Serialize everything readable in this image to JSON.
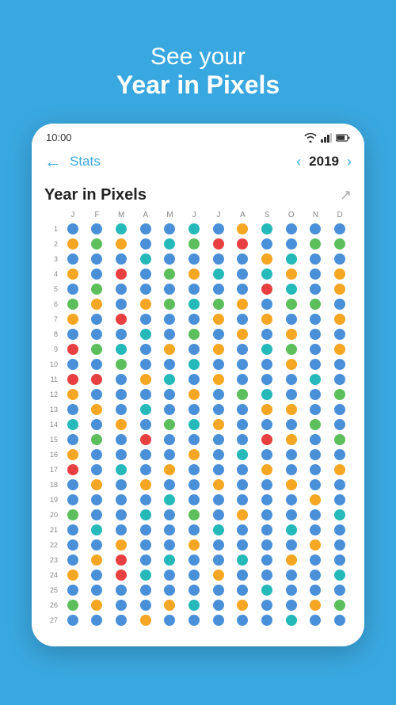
{
  "hero": {
    "line1": "See your",
    "line2": "Year in Pixels"
  },
  "statusBar": {
    "time": "10:00"
  },
  "nav": {
    "backLabel": "←",
    "statsLabel": "Stats",
    "chevronLeft": "‹",
    "chevronRight": "›",
    "year": "2019"
  },
  "section": {
    "title": "Year in Pixels",
    "shareIcon": "↗"
  },
  "months": [
    "J",
    "F",
    "M",
    "A",
    "M",
    "J",
    "J",
    "A",
    "S",
    "O",
    "N",
    "D"
  ],
  "rows": [
    {
      "day": 1,
      "dots": [
        "blue",
        "blue",
        "teal",
        "blue",
        "blue",
        "teal",
        "blue",
        "orange",
        "teal",
        "blue",
        "blue",
        "blue"
      ]
    },
    {
      "day": 2,
      "dots": [
        "orange",
        "green",
        "orange",
        "blue",
        "teal",
        "green",
        "red",
        "red",
        "blue",
        "blue",
        "green",
        "green"
      ]
    },
    {
      "day": 3,
      "dots": [
        "blue",
        "blue",
        "blue",
        "teal",
        "blue",
        "blue",
        "blue",
        "blue",
        "orange",
        "teal",
        "blue",
        "blue"
      ]
    },
    {
      "day": 4,
      "dots": [
        "orange",
        "blue",
        "red",
        "blue",
        "green",
        "orange",
        "teal",
        "blue",
        "teal",
        "orange",
        "blue",
        "orange"
      ]
    },
    {
      "day": 5,
      "dots": [
        "blue",
        "green",
        "blue",
        "blue",
        "blue",
        "blue",
        "blue",
        "blue",
        "red",
        "teal",
        "blue",
        "orange"
      ]
    },
    {
      "day": 6,
      "dots": [
        "green",
        "orange",
        "blue",
        "orange",
        "green",
        "teal",
        "green",
        "orange",
        "blue",
        "green",
        "green",
        "blue"
      ]
    },
    {
      "day": 7,
      "dots": [
        "orange",
        "blue",
        "red",
        "blue",
        "blue",
        "blue",
        "orange",
        "blue",
        "orange",
        "blue",
        "blue",
        "orange"
      ]
    },
    {
      "day": 8,
      "dots": [
        "blue",
        "blue",
        "blue",
        "teal",
        "blue",
        "green",
        "blue",
        "orange",
        "blue",
        "orange",
        "blue",
        "blue"
      ]
    },
    {
      "day": 9,
      "dots": [
        "red",
        "green",
        "teal",
        "blue",
        "orange",
        "blue",
        "orange",
        "blue",
        "teal",
        "green",
        "blue",
        "orange"
      ]
    },
    {
      "day": 10,
      "dots": [
        "blue",
        "blue",
        "green",
        "blue",
        "blue",
        "teal",
        "blue",
        "blue",
        "blue",
        "orange",
        "blue",
        "blue"
      ]
    },
    {
      "day": 11,
      "dots": [
        "red",
        "red",
        "blue",
        "orange",
        "teal",
        "blue",
        "orange",
        "blue",
        "blue",
        "blue",
        "teal",
        "blue"
      ]
    },
    {
      "day": 12,
      "dots": [
        "orange",
        "blue",
        "blue",
        "blue",
        "blue",
        "orange",
        "blue",
        "green",
        "teal",
        "blue",
        "blue",
        "green"
      ]
    },
    {
      "day": 13,
      "dots": [
        "blue",
        "orange",
        "blue",
        "teal",
        "blue",
        "blue",
        "blue",
        "blue",
        "orange",
        "orange",
        "blue",
        "blue"
      ]
    },
    {
      "day": 14,
      "dots": [
        "teal",
        "blue",
        "orange",
        "blue",
        "green",
        "teal",
        "orange",
        "blue",
        "blue",
        "blue",
        "green",
        "blue"
      ]
    },
    {
      "day": 15,
      "dots": [
        "blue",
        "green",
        "blue",
        "red",
        "blue",
        "blue",
        "blue",
        "blue",
        "red",
        "orange",
        "blue",
        "green"
      ]
    },
    {
      "day": 16,
      "dots": [
        "orange",
        "blue",
        "blue",
        "blue",
        "blue",
        "orange",
        "blue",
        "teal",
        "blue",
        "blue",
        "blue",
        "blue"
      ]
    },
    {
      "day": 17,
      "dots": [
        "red",
        "blue",
        "teal",
        "blue",
        "orange",
        "blue",
        "blue",
        "blue",
        "orange",
        "blue",
        "blue",
        "orange"
      ]
    },
    {
      "day": 18,
      "dots": [
        "blue",
        "orange",
        "blue",
        "orange",
        "blue",
        "blue",
        "orange",
        "blue",
        "blue",
        "orange",
        "blue",
        "blue"
      ]
    },
    {
      "day": 19,
      "dots": [
        "blue",
        "blue",
        "blue",
        "blue",
        "teal",
        "blue",
        "blue",
        "blue",
        "blue",
        "blue",
        "orange",
        "blue"
      ]
    },
    {
      "day": 20,
      "dots": [
        "green",
        "blue",
        "blue",
        "teal",
        "blue",
        "green",
        "blue",
        "orange",
        "blue",
        "blue",
        "blue",
        "teal"
      ]
    },
    {
      "day": 21,
      "dots": [
        "blue",
        "teal",
        "blue",
        "blue",
        "blue",
        "blue",
        "teal",
        "blue",
        "blue",
        "teal",
        "blue",
        "blue"
      ]
    },
    {
      "day": 22,
      "dots": [
        "blue",
        "blue",
        "orange",
        "blue",
        "blue",
        "orange",
        "blue",
        "blue",
        "blue",
        "blue",
        "orange",
        "blue"
      ]
    },
    {
      "day": 23,
      "dots": [
        "blue",
        "orange",
        "red",
        "blue",
        "teal",
        "blue",
        "blue",
        "teal",
        "blue",
        "orange",
        "blue",
        "blue"
      ]
    },
    {
      "day": 24,
      "dots": [
        "orange",
        "blue",
        "red",
        "teal",
        "blue",
        "blue",
        "orange",
        "blue",
        "blue",
        "blue",
        "blue",
        "teal"
      ]
    },
    {
      "day": 25,
      "dots": [
        "blue",
        "blue",
        "blue",
        "blue",
        "blue",
        "blue",
        "blue",
        "blue",
        "teal",
        "blue",
        "blue",
        "blue"
      ]
    },
    {
      "day": 26,
      "dots": [
        "green",
        "orange",
        "blue",
        "blue",
        "orange",
        "teal",
        "blue",
        "orange",
        "blue",
        "blue",
        "orange",
        "green"
      ]
    },
    {
      "day": 27,
      "dots": [
        "blue",
        "blue",
        "blue",
        "orange",
        "blue",
        "blue",
        "blue",
        "blue",
        "blue",
        "teal",
        "blue",
        "blue"
      ]
    }
  ]
}
